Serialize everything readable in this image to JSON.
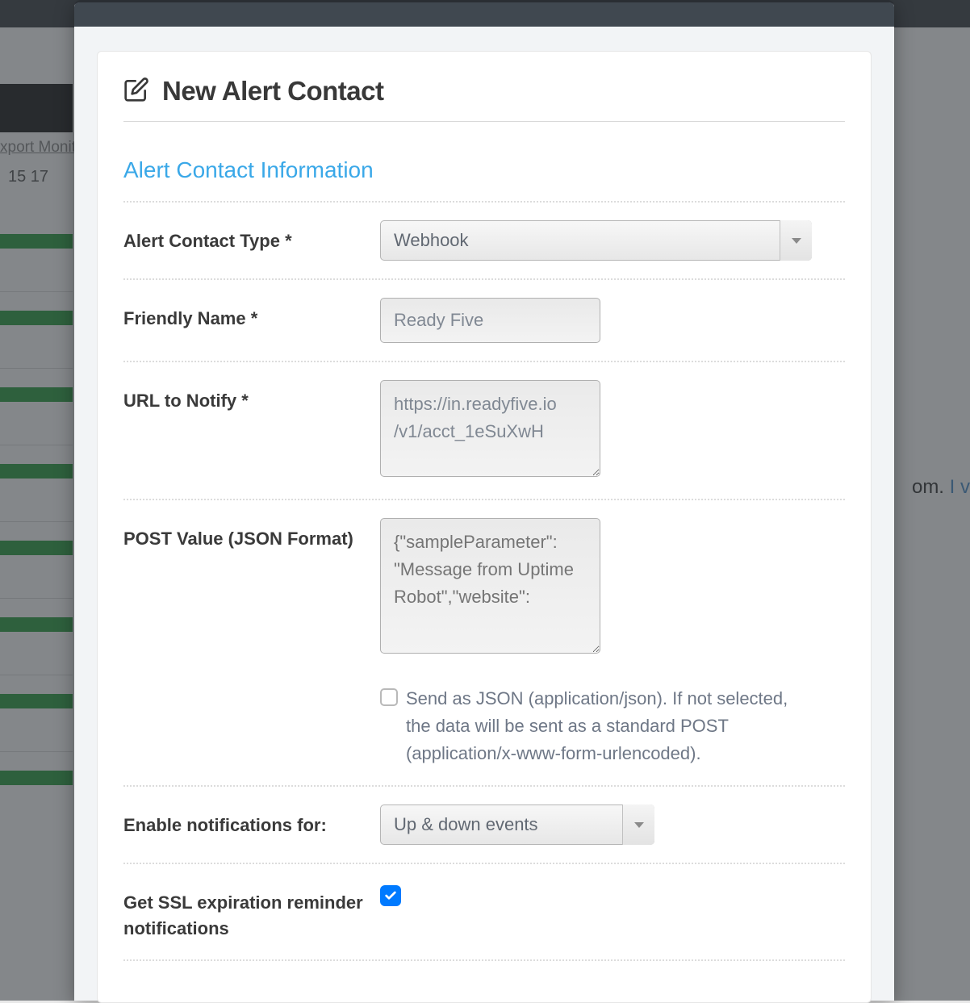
{
  "background": {
    "link_text": "xport Monit",
    "numbers": "15  17",
    "right_text_plain": "om.",
    "right_text_link": " I v"
  },
  "modal": {
    "title": "New Alert Contact",
    "section_title": "Alert Contact Information",
    "fields": {
      "contact_type": {
        "label": "Alert Contact Type *",
        "value": "Webhook"
      },
      "friendly_name": {
        "label": "Friendly Name *",
        "value": "Ready Five"
      },
      "url_notify": {
        "label": "URL to Notify *",
        "value": "https://in.readyfive.io\n/v1/acct_1eSuXwH"
      },
      "post_value": {
        "label": "POST Value (JSON Format)",
        "placeholder": "{\"sampleParameter\": \"Message from Uptime Robot\",\"website\":",
        "send_json_text": "Send as JSON (application/json). If not selected, the data will be sent as a standard POST (application/x-www-form-urlencoded)."
      },
      "enable_notifications": {
        "label": "Enable notifications for:",
        "value": "Up & down events"
      },
      "ssl_reminder": {
        "label": "Get SSL expiration reminder notifications",
        "checked": true
      }
    }
  }
}
